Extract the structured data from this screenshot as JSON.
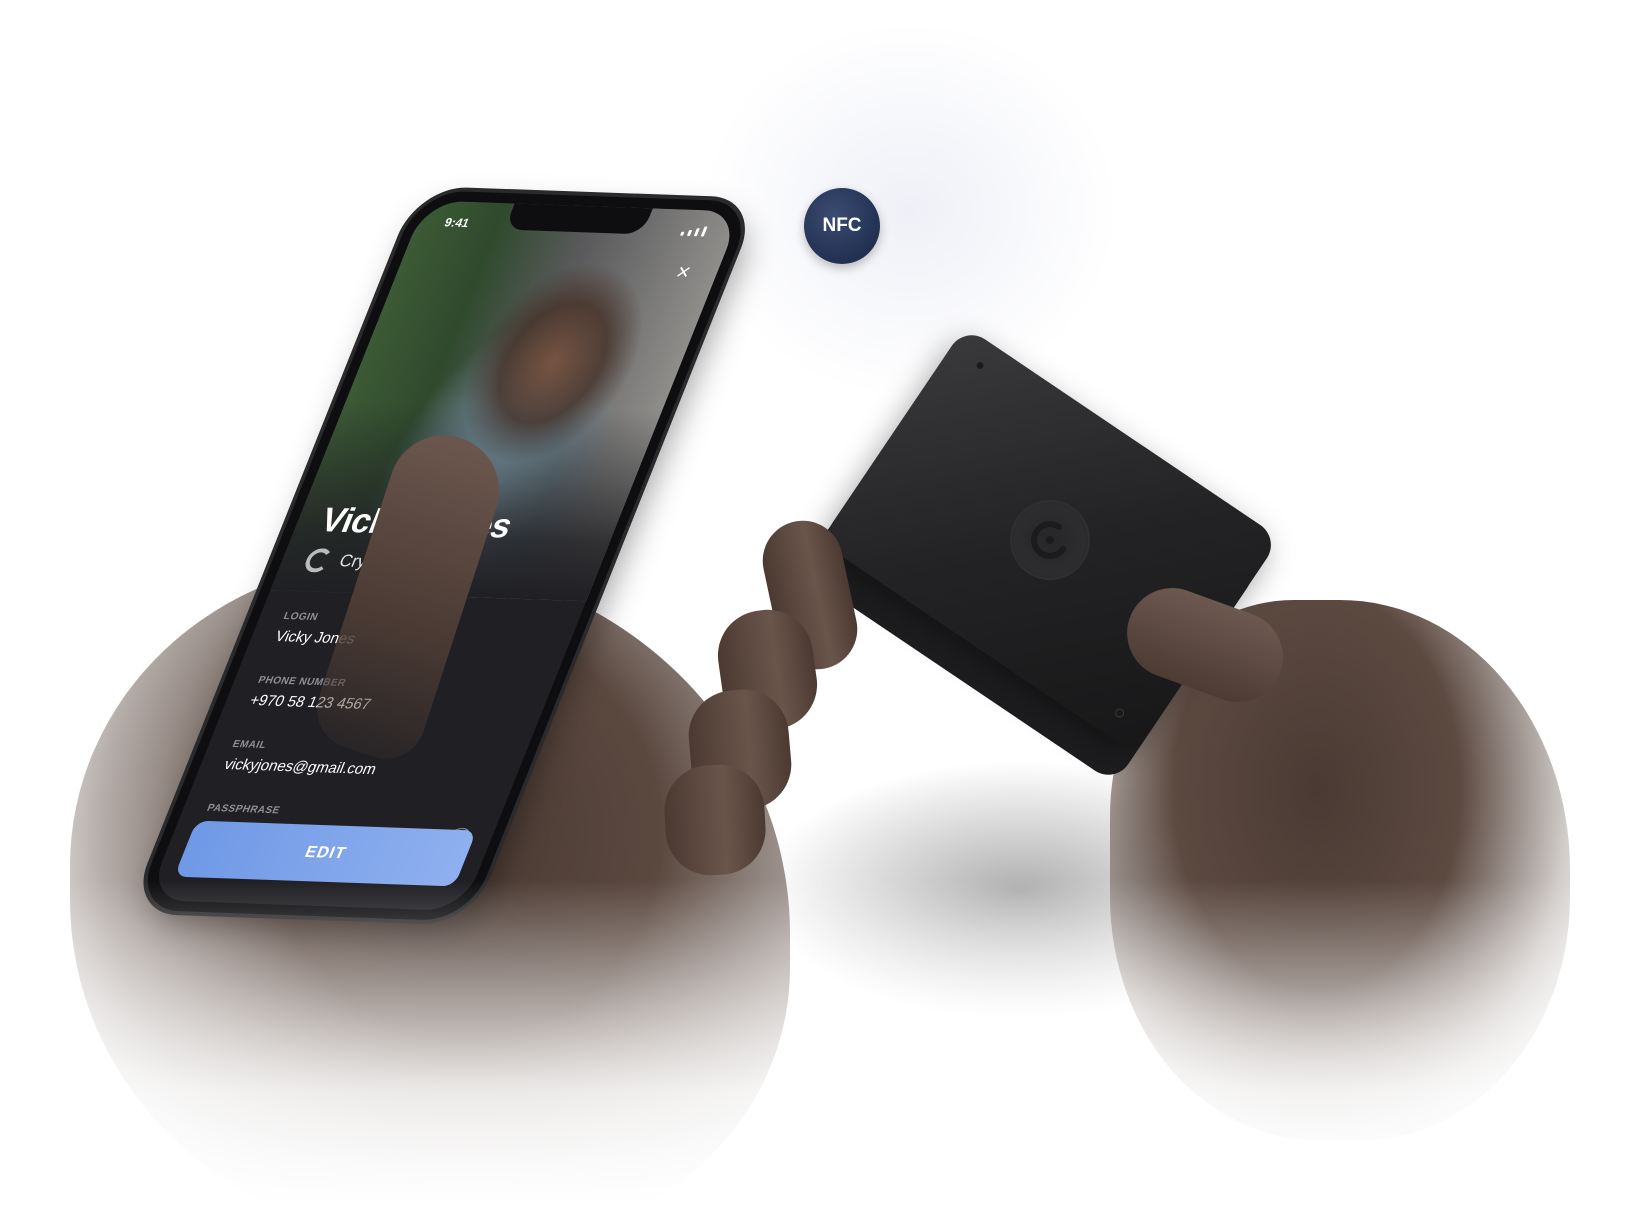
{
  "status_bar": {
    "time": "9:41"
  },
  "badge": {
    "label": "NFC"
  },
  "profile": {
    "name": "Vicky Jones",
    "subtitle": "Cryp • Case X Pro"
  },
  "fields": [
    {
      "label": "LOGIN",
      "value": "Vicky Jones"
    },
    {
      "label": "PHONE NUMBER",
      "value": "+970 58 123 4567"
    },
    {
      "label": "EMAIL",
      "value": "vickyjones@gmail.com"
    },
    {
      "label": "PASSPHRASE",
      "value": "**************"
    }
  ],
  "actions": {
    "edit_label": "EDIT"
  },
  "colors": {
    "accent": "#6f99e6",
    "badge": "#223152",
    "screen_bg": "#202024"
  },
  "icons": {
    "close": "close-icon",
    "visibility": "eye-icon",
    "brand": "cryp-logo-icon"
  }
}
